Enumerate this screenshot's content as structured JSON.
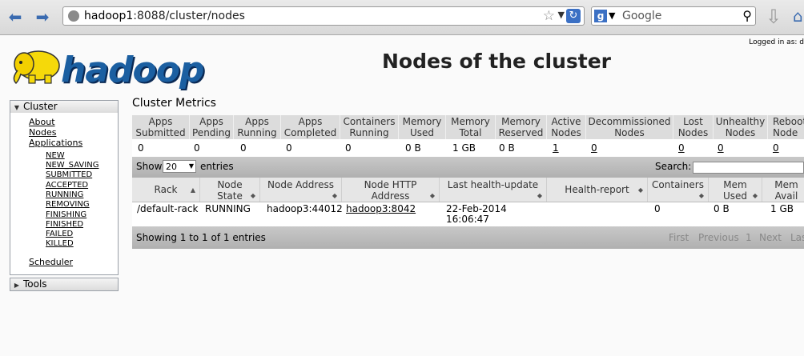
{
  "browser": {
    "url_host": "hadoop1",
    "url_rest": ":8088/cluster/nodes",
    "search_placeholder": "Google"
  },
  "header": {
    "logged_in": "Logged in as: d",
    "logo_text": "hadoop",
    "title": "Nodes of the cluster"
  },
  "sidebar": {
    "cluster_label": "Cluster",
    "links": [
      "About",
      "Nodes",
      "Applications"
    ],
    "app_states": [
      "NEW",
      "NEW_SAVING",
      "SUBMITTED",
      "ACCEPTED",
      "RUNNING",
      "REMOVING",
      "FINISHING",
      "FINISHED",
      "FAILED",
      "KILLED"
    ],
    "scheduler": "Scheduler",
    "tools_label": "Tools"
  },
  "metrics": {
    "title": "Cluster Metrics",
    "headers": [
      [
        "Apps",
        "Submitted"
      ],
      [
        "Apps",
        "Pending"
      ],
      [
        "Apps",
        "Running"
      ],
      [
        "Apps",
        "Completed"
      ],
      [
        "Containers",
        "Running"
      ],
      [
        "Memory",
        "Used"
      ],
      [
        "Memory",
        "Total"
      ],
      [
        "Memory",
        "Reserved"
      ],
      [
        "Active",
        "Nodes"
      ],
      [
        "Decommissioned",
        "Nodes"
      ],
      [
        "Lost",
        "Nodes"
      ],
      [
        "Unhealthy",
        "Nodes"
      ],
      [
        "Reboot",
        "Node"
      ]
    ],
    "values": [
      "0",
      "0",
      "0",
      "0",
      "0",
      "0 B",
      "1 GB",
      "0 B",
      "1",
      "0",
      "0",
      "0",
      "0"
    ]
  },
  "table": {
    "show_label": "Show",
    "page_size": "20",
    "entries_label": "entries",
    "search_label": "Search:",
    "headers": [
      [
        "Rack",
        ""
      ],
      [
        "Node",
        "State"
      ],
      [
        "Node Address",
        ""
      ],
      [
        "Node HTTP",
        "Address"
      ],
      [
        "Last health-update",
        ""
      ],
      [
        "Health-report",
        ""
      ],
      [
        "Containers",
        ""
      ],
      [
        "Mem",
        "Used"
      ],
      [
        "Mem",
        "Avail"
      ]
    ],
    "rows": [
      {
        "rack": "/default-rack",
        "state": "RUNNING",
        "address": "hadoop3:44012",
        "http_address": "hadoop3:8042",
        "last_update_date": "22-Feb-2014",
        "last_update_time": "16:06:47",
        "health_report": "",
        "containers": "0",
        "mem_used": "0 B",
        "mem_avail": "1 GB"
      }
    ],
    "info": "Showing 1 to 1 of 1 entries",
    "pager": [
      "First",
      "Previous",
      "1",
      "Next",
      "Last"
    ]
  }
}
